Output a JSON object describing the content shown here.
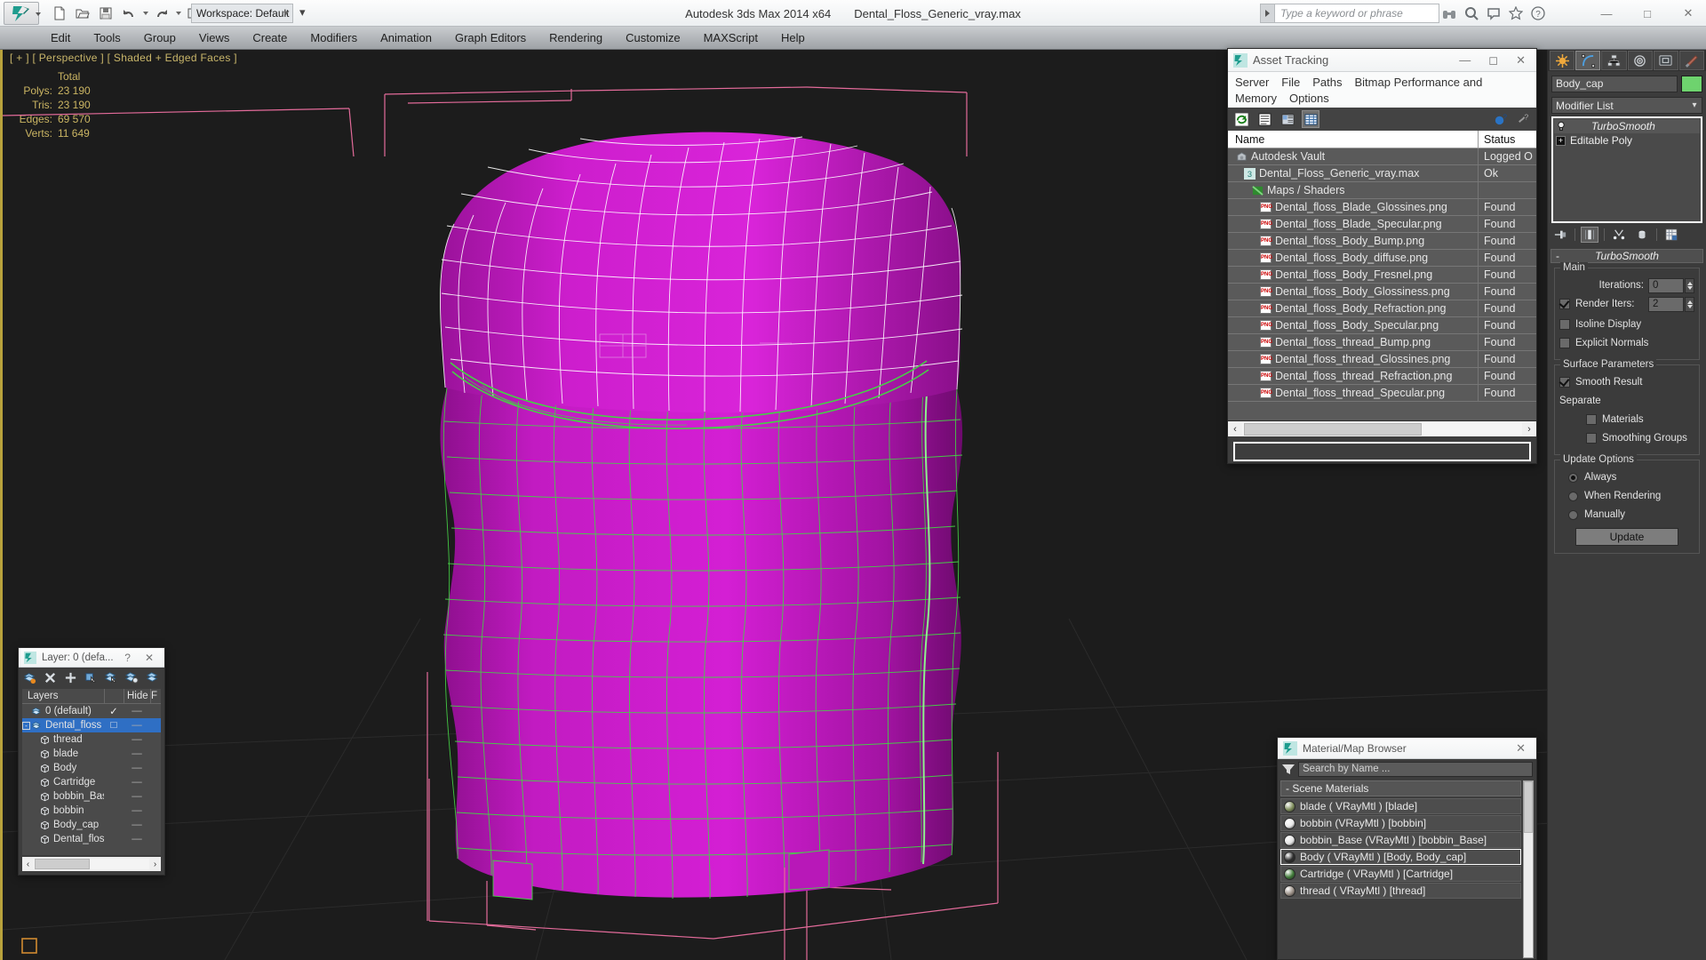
{
  "titlebar": {
    "app_title": "Autodesk 3ds Max  2014 x64",
    "file_title": "Dental_Floss_Generic_vray.max",
    "workspace": "Workspace: Default",
    "search_placeholder": "Type a keyword or phrase",
    "quick_access": [
      {
        "name": "new-file-icon",
        "label": "New"
      },
      {
        "name": "open-file-icon",
        "label": "Open"
      },
      {
        "name": "save-file-icon",
        "label": "Save"
      },
      {
        "name": "undo-icon",
        "label": "Undo"
      },
      {
        "name": "redo-icon",
        "label": "Redo"
      },
      {
        "name": "project-folder-icon",
        "label": "Set Project Folder"
      }
    ],
    "window_controls": {
      "minimize": "—",
      "maximize": "□",
      "close": "✕"
    }
  },
  "menubar": {
    "items": [
      "Edit",
      "Tools",
      "Group",
      "Views",
      "Create",
      "Modifiers",
      "Animation",
      "Graph Editors",
      "Rendering",
      "Customize",
      "MAXScript",
      "Help"
    ]
  },
  "viewport": {
    "label": "[ + ] [ Perspective ] [ Shaded + Edged Faces ]",
    "stats": {
      "header": "Total",
      "rows": [
        {
          "key": "Polys:",
          "value": "23 190"
        },
        {
          "key": "Tris:",
          "value": "23 190"
        },
        {
          "key": "Edges:",
          "value": "69 570"
        },
        {
          "key": "Verts:",
          "value": "11 649"
        }
      ]
    },
    "colors": {
      "body": "#c21bc2",
      "edge_selected": "#ffffff",
      "edge_unselected": "#46d046",
      "gizmo": "#e36b9a",
      "background": "#1c1c1c"
    }
  },
  "asset_tracking": {
    "title": "Asset Tracking",
    "menu": [
      "Server",
      "File",
      "Paths",
      "Bitmap Performance and Memory",
      "Options"
    ],
    "toolbar": [
      {
        "name": "refresh-icon",
        "active": false
      },
      {
        "name": "list-view-icon",
        "active": false
      },
      {
        "name": "thumbnail-view-icon",
        "active": false
      },
      {
        "name": "table-view-icon",
        "active": true
      },
      {
        "name": "help-web-icon",
        "active": false
      },
      {
        "name": "help-icon",
        "active": false
      }
    ],
    "columns": [
      "Name",
      "Status"
    ],
    "rows": [
      {
        "name": "Autodesk Vault",
        "status": "Logged O",
        "icon": "vault-icon",
        "indent": 1
      },
      {
        "name": "Dental_Floss_Generic_vray.max",
        "status": "Ok",
        "icon": "max-file-icon",
        "indent": 2
      },
      {
        "name": "Maps / Shaders",
        "status": "",
        "icon": "maps-icon",
        "indent": 3
      },
      {
        "name": "Dental_floss_Blade_Glossines.png",
        "status": "Found",
        "icon": "png-icon",
        "indent": 4
      },
      {
        "name": "Dental_floss_Blade_Specular.png",
        "status": "Found",
        "icon": "png-icon",
        "indent": 4
      },
      {
        "name": "Dental_floss_Body_Bump.png",
        "status": "Found",
        "icon": "png-icon",
        "indent": 4
      },
      {
        "name": "Dental_floss_Body_diffuse.png",
        "status": "Found",
        "icon": "png-icon",
        "indent": 4
      },
      {
        "name": "Dental_floss_Body_Fresnel.png",
        "status": "Found",
        "icon": "png-icon",
        "indent": 4
      },
      {
        "name": "Dental_floss_Body_Glossiness.png",
        "status": "Found",
        "icon": "png-icon",
        "indent": 4
      },
      {
        "name": "Dental_floss_Body_Refraction.png",
        "status": "Found",
        "icon": "png-icon",
        "indent": 4
      },
      {
        "name": "Dental_floss_Body_Specular.png",
        "status": "Found",
        "icon": "png-icon",
        "indent": 4
      },
      {
        "name": "Dental_floss_thread_Bump.png",
        "status": "Found",
        "icon": "png-icon",
        "indent": 4
      },
      {
        "name": "Dental_floss_thread_Glossines.png",
        "status": "Found",
        "icon": "png-icon",
        "indent": 4
      },
      {
        "name": "Dental_floss_thread_Refraction.png",
        "status": "Found",
        "icon": "png-icon",
        "indent": 4
      },
      {
        "name": "Dental_floss_thread_Specular.png",
        "status": "Found",
        "icon": "png-icon",
        "indent": 4
      }
    ]
  },
  "layer_window": {
    "title": "Layer: 0 (defa...",
    "help_label": "?",
    "close_label": "✕",
    "toolbar": [
      {
        "name": "new-layer-icon"
      },
      {
        "name": "delete-layer-icon"
      },
      {
        "name": "add-to-layer-icon"
      },
      {
        "name": "select-objects-in-layer-icon"
      },
      {
        "name": "select-highlighted-layer-icon"
      },
      {
        "name": "highlight-selected-objects-layer-icon"
      },
      {
        "name": "set-current-layer-icon"
      }
    ],
    "columns": [
      "Layers",
      "",
      "Hide",
      "F"
    ],
    "rows": [
      {
        "name": "0 (default)",
        "icon": "layer-icon",
        "current": "✓",
        "hide": "—",
        "indent": 1
      },
      {
        "name": "Dental_floss",
        "icon": "layer-icon",
        "current": "□",
        "hide": "—",
        "indent": 1,
        "selected": true,
        "expander": "-"
      },
      {
        "name": "thread",
        "icon": "object-icon",
        "current": "",
        "hide": "—",
        "indent": 2
      },
      {
        "name": "blade",
        "icon": "object-icon",
        "current": "",
        "hide": "—",
        "indent": 2
      },
      {
        "name": "Body",
        "icon": "object-icon",
        "current": "",
        "hide": "—",
        "indent": 2
      },
      {
        "name": "Cartridge",
        "icon": "object-icon",
        "current": "",
        "hide": "—",
        "indent": 2
      },
      {
        "name": "bobbin_Base",
        "icon": "object-icon",
        "current": "",
        "hide": "—",
        "indent": 2
      },
      {
        "name": "bobbin",
        "icon": "object-icon",
        "current": "",
        "hide": "—",
        "indent": 2
      },
      {
        "name": "Body_cap",
        "icon": "object-icon",
        "current": "",
        "hide": "—",
        "indent": 2
      },
      {
        "name": "Dental_floss",
        "icon": "object-icon",
        "current": "",
        "hide": "—",
        "indent": 2
      }
    ]
  },
  "material_browser": {
    "title": "Material/Map Browser",
    "close_label": "✕",
    "search_placeholder": "Search by Name ...",
    "group_label": "- Scene Materials",
    "materials": [
      {
        "label": "blade  ( VRayMtl )  [blade]",
        "swatch": "#7d8c5a",
        "selected": false
      },
      {
        "label": "bobbin  (VRayMtl )  [bobbin]",
        "swatch": "#e8e8e8",
        "selected": false
      },
      {
        "label": "bobbin_Base  (VRayMtl )  [bobbin_Base]",
        "swatch": "#e3e3e3",
        "selected": false
      },
      {
        "label": "Body  ( VRayMtl )  [Body, Body_cap]",
        "swatch": "#2e2e2e",
        "selected": true
      },
      {
        "label": "Cartridge  ( VRayMtl )  [Cartridge]",
        "swatch": "#3f7a38",
        "selected": false
      },
      {
        "label": "thread  ( VRayMtl )  [thread]",
        "swatch": "#9a8f86",
        "selected": false
      }
    ]
  },
  "command_panel": {
    "tabs": [
      {
        "name": "create-tab",
        "icon": "star-icon",
        "active": false
      },
      {
        "name": "modify-tab",
        "icon": "curve-icon",
        "active": true
      },
      {
        "name": "hierarchy-tab",
        "icon": "hierarchy-icon",
        "active": false
      },
      {
        "name": "motion-tab",
        "icon": "motion-icon",
        "active": false
      },
      {
        "name": "display-tab",
        "icon": "display-icon",
        "active": false
      },
      {
        "name": "utilities-tab",
        "icon": "hammer-icon",
        "active": false
      }
    ],
    "object_name": "Body_cap",
    "object_color": "#6ed36e",
    "modifier_list_label": "Modifier List",
    "stack": [
      {
        "label": "TurboSmooth",
        "active": true,
        "icon": "lightbulb-icon"
      },
      {
        "label": "Editable Poly",
        "active": false,
        "icon": "plus-box-icon"
      }
    ],
    "stack_buttons": [
      {
        "name": "pin-stack-icon",
        "active": false
      },
      {
        "name": "show-end-result-icon",
        "active": true
      },
      {
        "name": "make-unique-icon",
        "active": false
      },
      {
        "name": "remove-modifier-icon",
        "active": false
      },
      {
        "name": "configure-modifier-sets-icon",
        "active": false
      }
    ],
    "turbosmooth": {
      "rollout_title": "TurboSmooth",
      "rollout_toggle": "-",
      "main_label": "Main",
      "iterations_label": "Iterations:",
      "iterations_value": "0",
      "render_iters_label": "Render Iters:",
      "render_iters_value": "2",
      "render_iters_checked": true,
      "isoline_label": "Isoline Display",
      "isoline_checked": false,
      "explicit_label": "Explicit Normals",
      "explicit_checked": false,
      "surface_label": "Surface Parameters",
      "smooth_result_label": "Smooth Result",
      "smooth_result_checked": true,
      "separate_label": "Separate",
      "materials_label": "Materials",
      "materials_checked": false,
      "smoothing_groups_label": "Smoothing Groups",
      "smoothing_groups_checked": false,
      "update_label": "Update Options",
      "update_options": [
        {
          "label": "Always",
          "selected": true
        },
        {
          "label": "When Rendering",
          "selected": false
        },
        {
          "label": "Manually",
          "selected": false
        }
      ],
      "update_button": "Update"
    }
  }
}
